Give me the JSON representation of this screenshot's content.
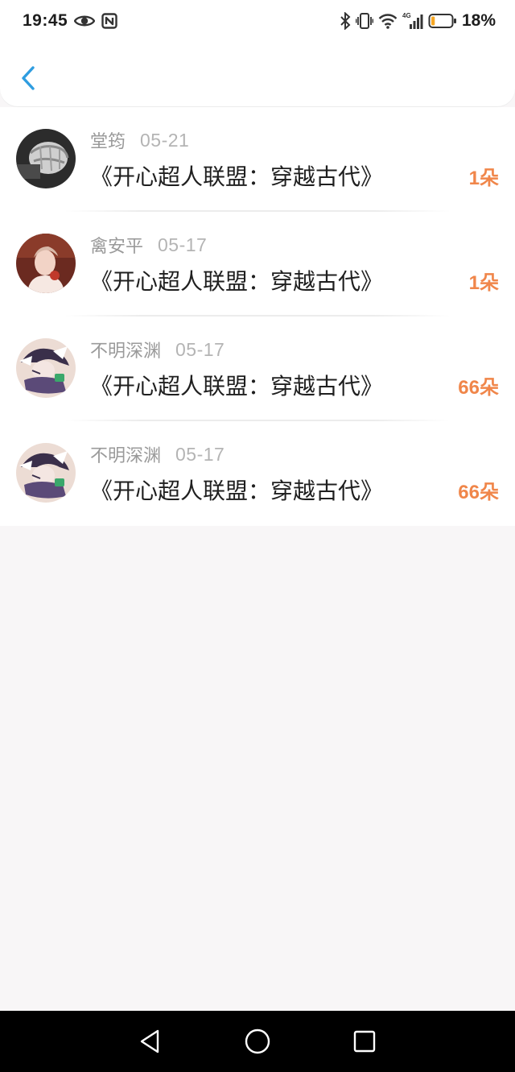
{
  "status_bar": {
    "time": "19:45",
    "battery_percent": "18%",
    "battery_level": 0.18,
    "icons": [
      "eye-icon",
      "nfc-icon",
      "bluetooth-icon",
      "vibrate-icon",
      "wifi-icon",
      "signal-4g-icon",
      "battery-icon"
    ],
    "network_label": "4G"
  },
  "header": {
    "back_icon": "chevron-left-icon"
  },
  "colors": {
    "accent_back": "#2f9de0",
    "count_orange": "#f0864a",
    "battery_orange": "#f5a623"
  },
  "gifts": [
    {
      "user": "堂筠",
      "date": "05-21",
      "title": "《开心超人联盟：穿越古代》",
      "count": "1朵",
      "avatar": "fist-avatar"
    },
    {
      "user": "禽安平",
      "date": "05-17",
      "title": "《开心超人联盟：穿越古代》",
      "count": "1朵",
      "avatar": "portrait-avatar"
    },
    {
      "user": "不明深渊",
      "date": "05-17",
      "title": "《开心超人联盟：穿越古代》",
      "count": "66朵",
      "avatar": "anime-avatar"
    },
    {
      "user": "不明深渊",
      "date": "05-17",
      "title": "《开心超人联盟：穿越古代》",
      "count": "66朵",
      "avatar": "anime-avatar"
    }
  ],
  "nav": {
    "icons": [
      "nav-back-icon",
      "nav-home-icon",
      "nav-recents-icon"
    ]
  }
}
